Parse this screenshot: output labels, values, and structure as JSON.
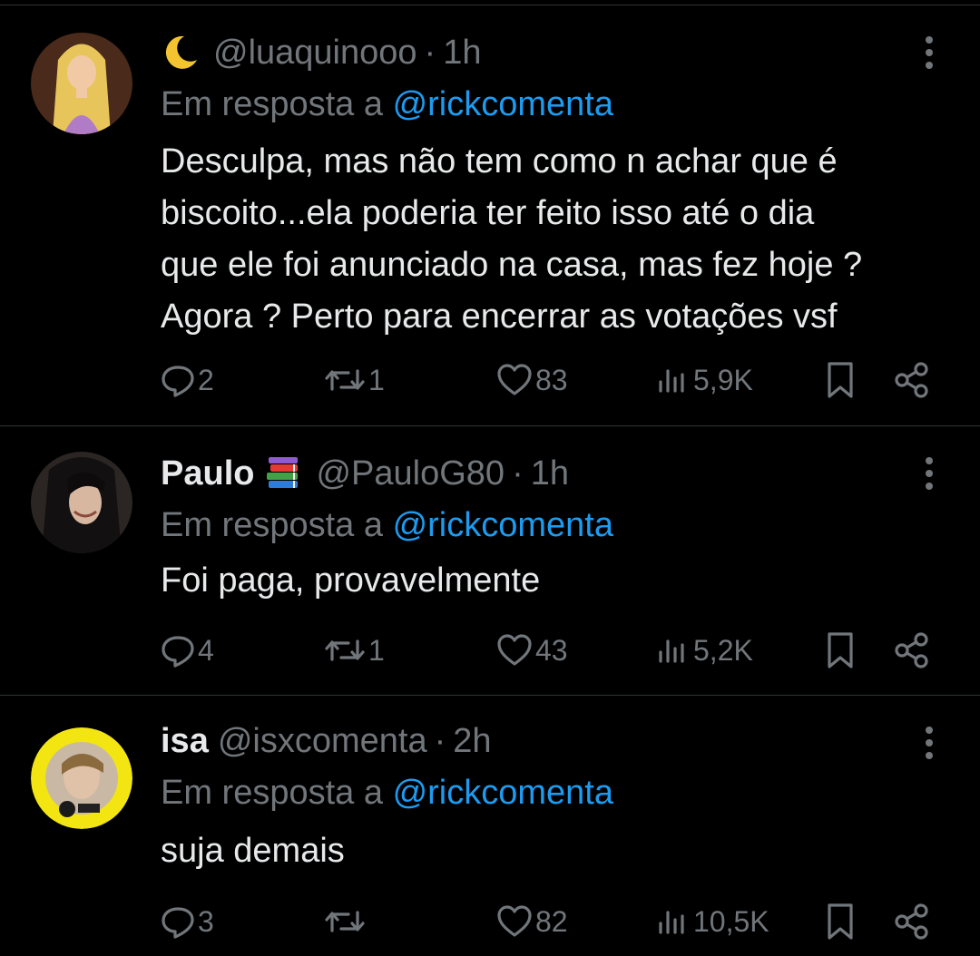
{
  "colors": {
    "background": "#000000",
    "text": "#e7e9ea",
    "muted": "#71767b",
    "link": "#1d9bf0",
    "divider": "#2f3336"
  },
  "replies": [
    {
      "display_name": "",
      "emoji": "crescent-moon",
      "handle": "@luaquinooo",
      "separator": "·",
      "time": "1h",
      "reply_prefix": "Em resposta a",
      "reply_to": "@rickcomenta",
      "text": "Desculpa, mas não tem como n achar que é\nbiscoito...ela poderia ter feito isso até o dia\nque ele foi anunciado na casa, mas fez hoje ?\nAgora ? Perto para encerrar as votações vsf",
      "replies_count": "2",
      "retweets_count": "1",
      "likes_count": "83",
      "views_count": "5,9K"
    },
    {
      "display_name": "Paulo",
      "emoji": "books",
      "handle": "@PauloG80",
      "separator": "·",
      "time": "1h",
      "reply_prefix": "Em resposta a",
      "reply_to": "@rickcomenta",
      "text": "Foi paga, provavelmente",
      "replies_count": "4",
      "retweets_count": "1",
      "likes_count": "43",
      "views_count": "5,2K"
    },
    {
      "display_name": "isa",
      "emoji": "",
      "handle": "@isxcomenta",
      "separator": "·",
      "time": "2h",
      "reply_prefix": "Em resposta a",
      "reply_to": "@rickcomenta",
      "text": "suja demais",
      "replies_count": "3",
      "retweets_count": "",
      "likes_count": "82",
      "views_count": "10,5K"
    }
  ]
}
